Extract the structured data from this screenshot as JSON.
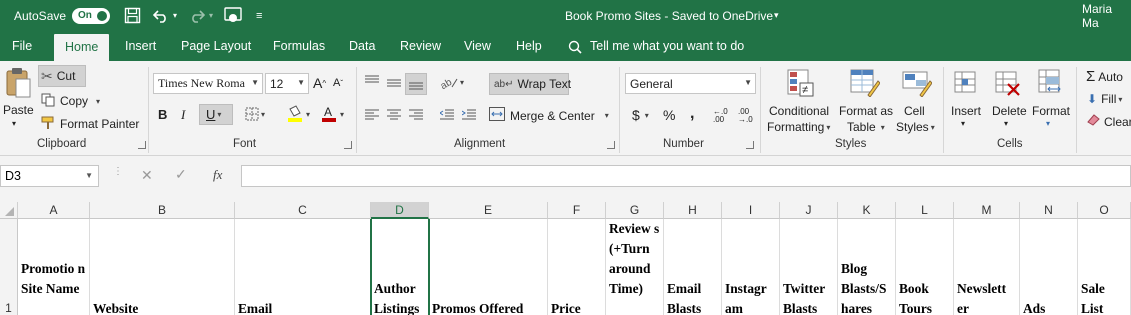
{
  "titlebar": {
    "autosave_label": "AutoSave",
    "autosave_state": "On",
    "document_title": "Book Promo Sites  -  Saved to OneDrive",
    "user_name": "Maria Ma"
  },
  "tabs": [
    "File",
    "Home",
    "Insert",
    "Page Layout",
    "Formulas",
    "Data",
    "Review",
    "View",
    "Help"
  ],
  "tell_me": "Tell me what you want to do",
  "clipboard": {
    "paste": "Paste",
    "cut": "Cut",
    "copy": "Copy",
    "format_painter": "Format Painter",
    "group": "Clipboard"
  },
  "font": {
    "name": "Times New Roma",
    "size": "12",
    "bold": "B",
    "italic": "I",
    "underline": "U",
    "group": "Font"
  },
  "alignment": {
    "wrap_text": "Wrap Text",
    "merge_center": "Merge & Center",
    "group": "Alignment"
  },
  "number": {
    "format": "General",
    "currency": "$",
    "percent": "%",
    "comma": ",",
    "group": "Number"
  },
  "styles": {
    "conditional_1": "Conditional",
    "conditional_2": "Formatting",
    "format_as_1": "Format as",
    "format_as_2": "Table",
    "cell_1": "Cell",
    "cell_2": "Styles",
    "group": "Styles"
  },
  "cells": {
    "insert": "Insert",
    "delete": "Delete",
    "format": "Format",
    "group": "Cells"
  },
  "editing": {
    "autosum": "Auto",
    "fill": "Fill",
    "clear": "Clear"
  },
  "formula_bar": {
    "name_box": "D3",
    "fx": "fx",
    "value": ""
  },
  "columns": [
    "A",
    "B",
    "C",
    "D",
    "E",
    "F",
    "G",
    "H",
    "I",
    "J",
    "K",
    "L",
    "M",
    "N",
    "O"
  ],
  "selected_column": "D",
  "row_number": "1",
  "row1": [
    "Promotio n Site Name",
    "Website",
    "Email",
    "Author Listings",
    "Promos Offered",
    "Price",
    "Review s (+Turn around Time)",
    "Email Blasts",
    "Instagr am",
    "Twitter Blasts",
    "Blog Blasts/S hares",
    "Book Tours",
    "Newslett er",
    "Ads",
    "Sale List"
  ],
  "colors": {
    "excel_green": "#217346",
    "ribbon_bg": "#f3f3f3"
  }
}
